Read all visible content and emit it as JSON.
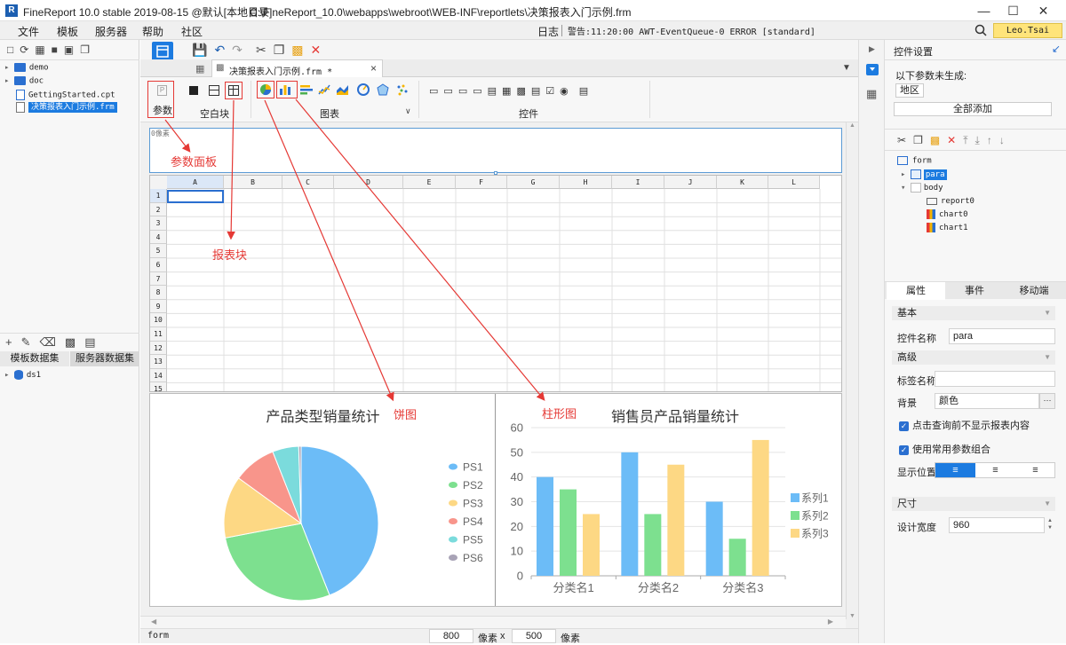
{
  "title": {
    "app": "FineReport 10.0 stable 2019-08-15 @默认[本地目录]",
    "path": "C:\\FineReport_10.0\\webapps\\webroot\\WEB-INF\\reportlets\\决策报表入门示例.frm"
  },
  "menu": [
    "文件",
    "模板",
    "服务器",
    "帮助",
    "社区"
  ],
  "status_bar": {
    "log": "日志",
    "alert": "警告:11:20:00 AWT-EventQueue-0 ERROR [standard]",
    "user": "Leo.Tsai"
  },
  "file_tree": [
    {
      "label": "demo",
      "type": "folder"
    },
    {
      "label": "doc",
      "type": "folder"
    },
    {
      "label": "GettingStarted.cpt",
      "type": "file"
    },
    {
      "label": "决策报表入门示例.frm",
      "type": "file",
      "selected": true
    }
  ],
  "dataset_tabs": [
    "模板数据集",
    "服务器数据集"
  ],
  "datasets": [
    "ds1"
  ],
  "editor_tab": {
    "label": "决策报表入门示例.frm *"
  },
  "widget_groups": {
    "param": "参数",
    "blank": "空白块",
    "chart": "图表",
    "control": "控件"
  },
  "canvas": {
    "param_hint": "0像素",
    "columns": [
      "A",
      "B",
      "C",
      "D",
      "E",
      "F",
      "G",
      "H",
      "I",
      "J",
      "K",
      "L"
    ],
    "rows": [
      "1",
      "2",
      "3",
      "4",
      "5",
      "6",
      "7",
      "8",
      "9",
      "10",
      "11",
      "12",
      "13",
      "14",
      "15"
    ]
  },
  "annotations": {
    "param_panel": "参数面板",
    "report_block": "报表块",
    "pie": "饼图",
    "bar": "柱形图"
  },
  "colors": {
    "pie": [
      "#6cbcf7",
      "#7de08f",
      "#fdd884",
      "#f8958b",
      "#7bdbdc",
      "#a8a3b6"
    ],
    "bar": [
      "#6cbcf7",
      "#7de08f",
      "#fdd884"
    ],
    "accent": "#1c5fb1",
    "annotation": "#e53935"
  },
  "chart_data": [
    {
      "type": "pie",
      "title": "产品类型销量统计",
      "categories": [
        "PS1",
        "PS2",
        "PS3",
        "PS4",
        "PS5",
        "PS6"
      ],
      "values": [
        44,
        28,
        13,
        9,
        5.5,
        0.5
      ],
      "legend": "right"
    },
    {
      "type": "bar",
      "title": "销售员产品销量统计",
      "categories": [
        "分类名1",
        "分类名2",
        "分类名3"
      ],
      "series": [
        {
          "name": "系列1",
          "values": [
            40,
            50,
            30
          ]
        },
        {
          "name": "系列2",
          "values": [
            35,
            25,
            15
          ]
        },
        {
          "name": "系列3",
          "values": [
            25,
            45,
            55
          ]
        }
      ],
      "ylim": [
        0,
        60
      ],
      "yticks": [
        0,
        10,
        20,
        30,
        40,
        50,
        60
      ],
      "legend": "right",
      "grid": true
    }
  ],
  "bottom_bar": {
    "mode": "form",
    "width": "800",
    "height": "500",
    "unit": "像素",
    "times": "x"
  },
  "right_panel": {
    "header": "控件设置",
    "note": "以下参数未生成:",
    "param_chip": "地区",
    "add_all": "全部添加",
    "tree": [
      {
        "label": "form",
        "level": 0
      },
      {
        "label": "para",
        "level": 1,
        "selected": true
      },
      {
        "label": "body",
        "level": 1
      },
      {
        "label": "report0",
        "level": 2
      },
      {
        "label": "chart0",
        "level": 2
      },
      {
        "label": "chart1",
        "level": 2
      }
    ],
    "tabs": [
      "属性",
      "事件",
      "移动端"
    ],
    "section_basic": "基本",
    "name_label": "控件名称",
    "name_value": "para",
    "section_advanced": "高级",
    "tag_label": "标签名称",
    "bg_label": "背景",
    "bg_value": "颜色",
    "bg_more": "···",
    "check1": "点击查询前不显示报表内容",
    "check2": "使用常用参数组合",
    "position_label": "显示位置",
    "section_size": "尺寸",
    "width_label": "设计宽度",
    "width_value": "960"
  }
}
